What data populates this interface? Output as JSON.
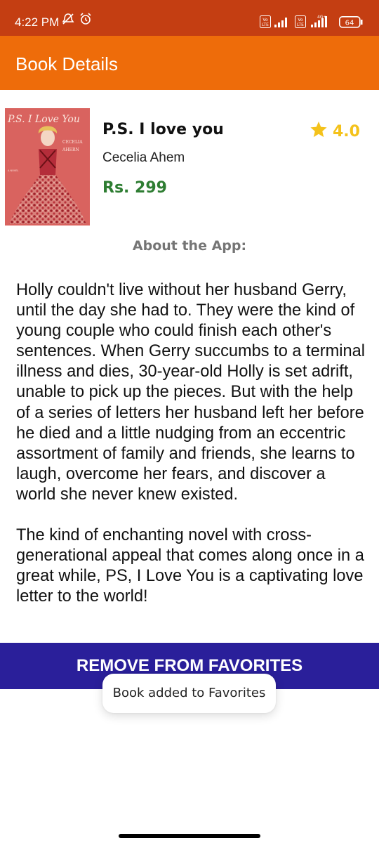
{
  "status_bar": {
    "time": "4:22 PM",
    "battery": "64",
    "icons": [
      "mute-icon",
      "alarm-icon",
      "volte-icon",
      "signal-icon",
      "volte-icon",
      "signal-4g-icon",
      "battery-icon"
    ]
  },
  "app_bar": {
    "title": "Book Details"
  },
  "book": {
    "title": "P.S. I love you",
    "author": "Cecelia Ahem",
    "price": "Rs. 299",
    "rating": "4.0",
    "cover": {
      "script_title": "P.S. I Love You",
      "author_line1": "CECELIA",
      "author_line2": "AHERN",
      "tag": "A NOVEL"
    }
  },
  "about": {
    "heading": "About the App:",
    "description": "Holly couldn't live without her husband Gerry, until the day she had to. They were the kind of young couple who could finish each other's sentences. When Gerry succumbs to a terminal illness and dies, 30-year-old Holly is set adrift, unable to pick up the pieces. But with the help of a series of letters her husband left her before he died and a little nudging from an eccentric assortment of family and friends, she learns to laugh, overcome her fears, and discover a world she never knew existed.\n\nThe kind of enchanting novel with cross-generational appeal that comes along once in a great while, PS, I Love You is a captivating love letter to the world!"
  },
  "favorites_button": {
    "label": "REMOVE FROM FAVORITES"
  },
  "toast": {
    "message": "Book added to Favorites"
  },
  "colors": {
    "status_bar": "#c43e12",
    "app_bar": "#ee6c0a",
    "price": "#2e7d32",
    "rating": "#f4c21b",
    "button": "#2a1f9a"
  }
}
